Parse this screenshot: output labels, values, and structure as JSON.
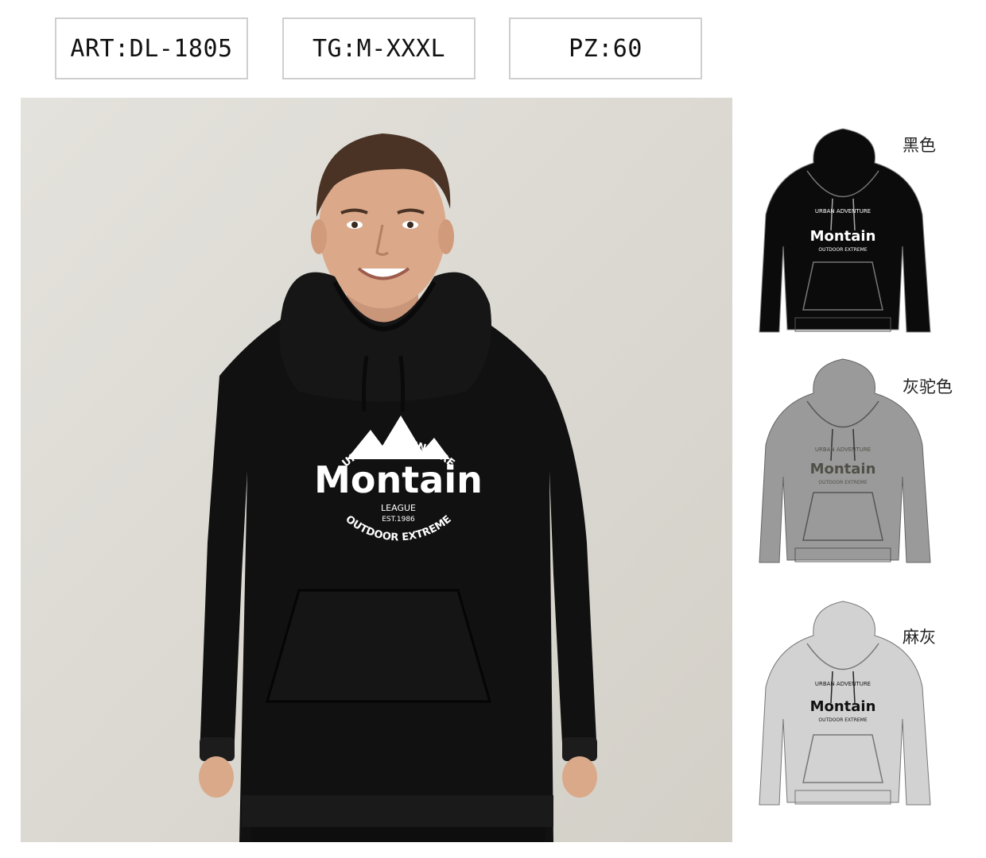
{
  "specs": {
    "art": "ART:DL-1805",
    "sizes": "TG:M-XXXL",
    "pieces": "PZ:60"
  },
  "print": {
    "arc_top": "URBAN ADVENTURE",
    "brand": "Montain",
    "league": "LEAGUE",
    "est": "EST.1986",
    "arc_bottom": "OUTDOOR EXTREME"
  },
  "colorways": [
    {
      "label": "黑色",
      "fill": "#0b0b0b",
      "ink": "#ffffff"
    },
    {
      "label": "灰驼色",
      "fill": "#9a9a9a",
      "ink": "#505048"
    },
    {
      "label": "麻灰",
      "fill": "#d2d2d2",
      "ink": "#111111"
    }
  ],
  "colors": {
    "backdrop": "#dddad3",
    "hoodie_black": "#111111",
    "skin": "#d9a989",
    "hair": "#4a3324"
  }
}
